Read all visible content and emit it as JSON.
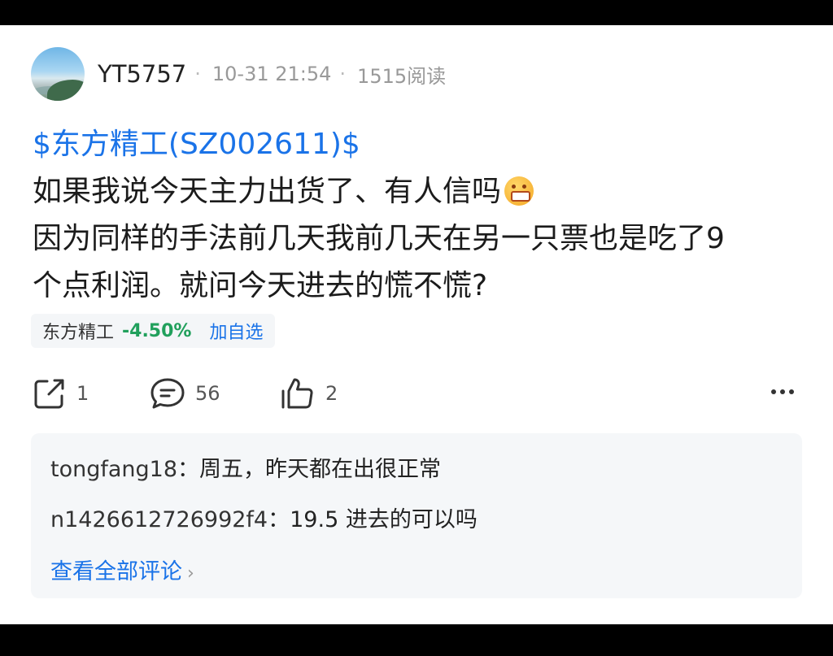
{
  "post": {
    "username": "YT5757",
    "separator": "·",
    "timestamp": "10-31 21:54",
    "reads": "1515阅读",
    "stock_link": "$东方精工(SZ002611)$",
    "lines": [
      "如果我说今天主力出货了、有人信吗",
      "因为同样的手法前几天我前几天在另一只票也是吃了9",
      "个点利润。就问今天进去的慌不慌?"
    ]
  },
  "stock_chip": {
    "name": "东方精工",
    "change": "-4.50%",
    "add_label": "加自选",
    "change_color": "#21a05c"
  },
  "actions": {
    "share_count": "1",
    "comment_count": "56",
    "like_count": "2"
  },
  "comments": [
    {
      "author": "tongfang18",
      "sep": "：",
      "text": "周五，昨天都在出很正常"
    },
    {
      "author": "n1426612726992f4",
      "sep": "：",
      "text": "19.5 进去的可以吗"
    }
  ],
  "view_all_label": "查看全部评论",
  "colors": {
    "link": "#1a73e8",
    "down": "#21a05c"
  }
}
